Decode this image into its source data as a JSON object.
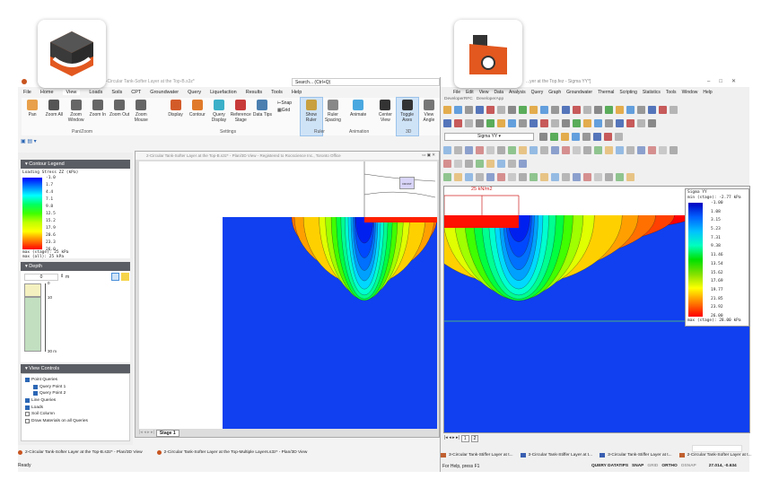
{
  "left_app": {
    "title": "2-Circular Tank-Softer Layer at the Top-B.s3z*",
    "search_placeholder": "Search... (Ctrl+Q)",
    "menu": [
      "File",
      "Home",
      "View",
      "Loads",
      "Soils",
      "CPT",
      "Groundwater",
      "Query",
      "Liquefaction",
      "Results",
      "Tools",
      "Help"
    ],
    "active_menu": "View",
    "ribbon": [
      {
        "label": "Pan",
        "icon": "pan-hand-icon",
        "color": "#e8a04a"
      },
      {
        "label": "Zoom All",
        "icon": "zoom-all-icon",
        "color": "#555"
      },
      {
        "label": "Zoom Window",
        "icon": "zoom-window-icon",
        "color": "#666"
      },
      {
        "label": "Zoom In",
        "icon": "zoom-in-icon",
        "color": "#666"
      },
      {
        "label": "Zoom Out",
        "icon": "zoom-out-icon",
        "color": "#666"
      },
      {
        "label": "Zoom Mouse",
        "icon": "zoom-mouse-icon",
        "color": "#666"
      },
      {
        "label": "Display",
        "icon": "display-icon",
        "color": "#d35b2a"
      },
      {
        "label": "Contour",
        "icon": "contour-icon",
        "color": "#e07a2a"
      },
      {
        "label": "Query Display",
        "icon": "query-display-icon",
        "color": "#3bb0c8"
      },
      {
        "label": "Reference Stage",
        "icon": "reference-stage-icon",
        "color": "#c83a3a"
      },
      {
        "label": "Data Tips",
        "icon": "data-tips-icon",
        "color": "#4a7fb0"
      },
      {
        "label": "Show Ruler",
        "icon": "ruler-icon",
        "color": "#c8a040",
        "active": true
      },
      {
        "label": "Ruler Spacing",
        "icon": "ruler-spacing-icon",
        "color": "#888"
      },
      {
        "label": "Animate",
        "icon": "animate-icon",
        "color": "#4aa8e0"
      },
      {
        "label": "Center View",
        "icon": "center-view-icon",
        "color": "#333"
      },
      {
        "label": "Toggle Axes",
        "icon": "axes-icon",
        "color": "#333",
        "active": true
      },
      {
        "label": "View Angle",
        "icon": "view-angle-icon",
        "color": "#777"
      }
    ],
    "snap_label": "Snap",
    "grid_label": "Grid",
    "groups": [
      "Pan/Zoom",
      "Settings",
      "Ruler",
      "Animation",
      "3D"
    ],
    "contour_legend": {
      "header": "Contour Legend",
      "title": "Loading Stress ZZ (kPa)",
      "values": [
        "-1.0",
        "1.7",
        "4.4",
        "7.1",
        "9.8",
        "12.5",
        "15.2",
        "17.9",
        "20.6",
        "23.3",
        "26.0"
      ],
      "max_stage": "max (stage): 25 kPa",
      "max_all": "max (all):   25 kPa"
    },
    "depth": {
      "header": "Depth",
      "value": "0",
      "unit": "m",
      "ticks": [
        "0",
        "10",
        "30 m"
      ]
    },
    "view_controls": {
      "header": "View Controls",
      "items": [
        {
          "label": "Point Queries",
          "checked": true,
          "level": 0
        },
        {
          "label": "Query Point 1",
          "checked": true,
          "level": 1
        },
        {
          "label": "Query Point 2",
          "checked": true,
          "level": 1
        },
        {
          "label": "Line Queries",
          "checked": true,
          "level": 0
        },
        {
          "label": "Loads",
          "checked": true,
          "level": 0
        },
        {
          "label": "Soil Column",
          "checked": false,
          "level": 0
        },
        {
          "label": "Draw Materials on all Queries",
          "checked": false,
          "level": 0
        }
      ]
    },
    "child_title": "2-Circular Tank-Softer Layer at the Top-B.s3z* - Plan/3D View - Registered to Rocscience Inc., Toronto Office",
    "stage_tab": "Stage 1",
    "tasks": [
      "2-Circular Tank-Softer Layer at the Top-B.s3z* - Plan/3D View",
      "2-Circular Tank-Softer Layer at the Top-Multiple Layers.s3z* - Plan/3D View"
    ],
    "status": "Ready"
  },
  "right_app": {
    "title": "...yer at the Top.fez - Sigma YY*]",
    "menu": [
      "File",
      "Edit",
      "View",
      "Data",
      "Analysis",
      "Query",
      "Graph",
      "Groundwater",
      "Thermal",
      "Scripting",
      "Statistics",
      "Tools",
      "Window",
      "Help"
    ],
    "submenu": [
      "DeveloperRFC",
      "DeveloperApp"
    ],
    "result_select": "Sigma YY",
    "load_label": "25 kN/m2",
    "legend": {
      "title": "Sigma YY",
      "min": "min (stage): -2.77 kPa",
      "values": [
        "-1.00",
        "1.08",
        "3.15",
        "5.23",
        "7.31",
        "9.38",
        "11.46",
        "13.54",
        "15.62",
        "17.69",
        "19.77",
        "21.85",
        "23.92",
        "26.00"
      ],
      "max": "max (stage): 28.00 kPa"
    },
    "stage_tabs": [
      "1",
      "2"
    ],
    "tasks": [
      "3-Circular Tank-Stiffer Layer at t...",
      "3-Circular Tank-Stiffer Layer at t...",
      "3-Circular Tank-Stiffer Layer at t...",
      "2-Circular Tank-Softer Layer at t..."
    ],
    "status_left": "For Help, press F1",
    "status_flags": [
      {
        "label": "QUERY DATATIPS",
        "on": true
      },
      {
        "label": "SNAP",
        "on": true
      },
      {
        "label": "GRID",
        "on": false
      },
      {
        "label": "ORTHO",
        "on": true
      },
      {
        "label": "OSNAP",
        "on": false
      }
    ],
    "coords": "27.014, -0.634"
  },
  "colors": {
    "accent": "#2c67b5",
    "ribbon_active": "#cfe3f7",
    "panel_header": "#5a5d63"
  }
}
